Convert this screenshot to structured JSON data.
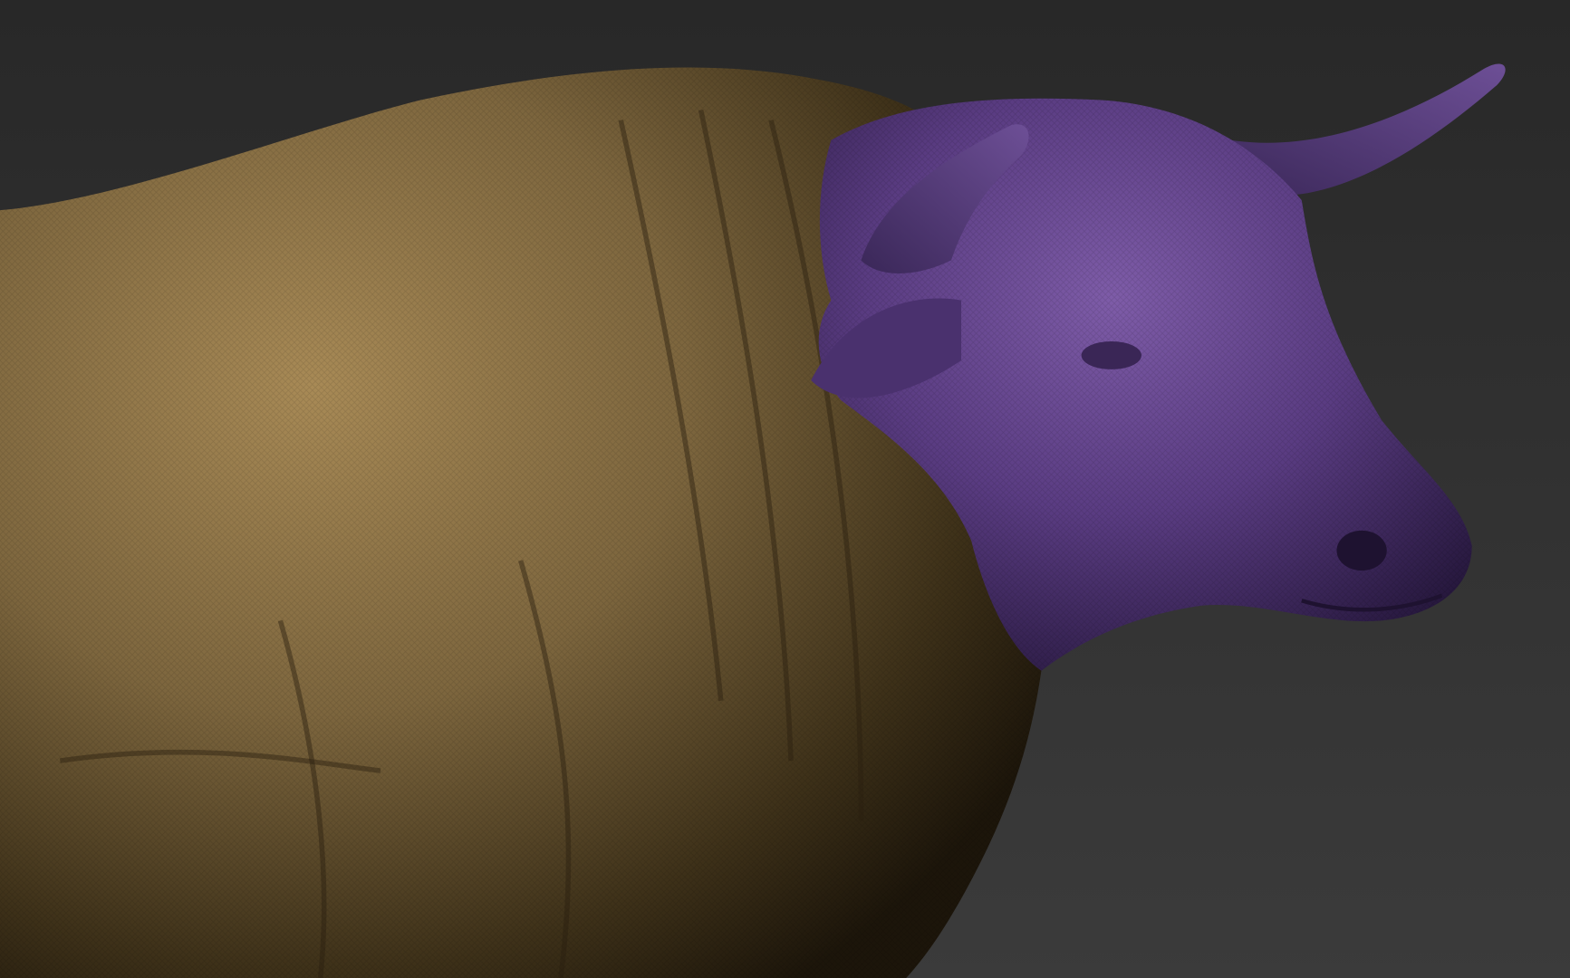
{
  "scene": {
    "subject": "bull-sculpt",
    "colors": {
      "background_top": "#2a2a2a",
      "background_bottom": "#3a3a3a",
      "body": "#8a7246",
      "body_shadow": "#2a2010",
      "head": "#5e3f86",
      "head_shadow": "#24163a",
      "head_highlight": "#8b6bb3"
    }
  }
}
